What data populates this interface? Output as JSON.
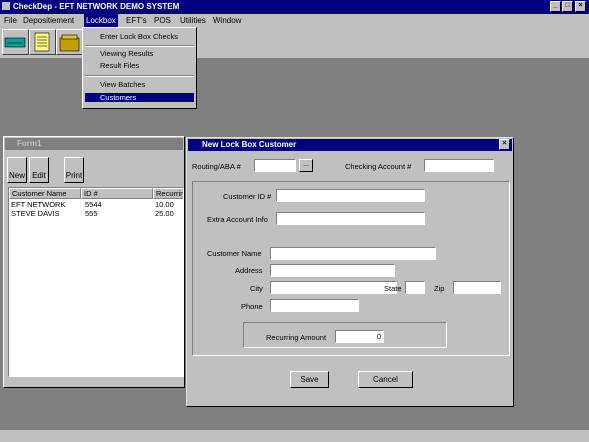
{
  "app": {
    "title": "CheckDep - EFT NETWORK DEMO SYSTEM",
    "min": "_",
    "max": "□",
    "close": "×"
  },
  "menubar": [
    "File",
    "Depositiement",
    "Lockbox",
    "EFT's",
    "POS",
    "Utilities",
    "Window"
  ],
  "lockbox_menu": [
    "Enter Lock Box Checks",
    "Viewing Results",
    "Result Files",
    "View Batches",
    "Customers"
  ],
  "form1": {
    "title": "Form1",
    "buttons": [
      "New",
      "Edit",
      "Print"
    ],
    "columns": [
      "Customer Name",
      "ID #",
      "Recurring"
    ],
    "rows": [
      [
        "EFT NETWORK",
        "5544",
        "10.00"
      ],
      [
        "STEVE DAVIS",
        "555",
        "25.00"
      ]
    ]
  },
  "dialog": {
    "title": "New Lock Box Customer",
    "close": "×",
    "routing_label": "Routing/ABA #",
    "routing_btn": "...",
    "checking_label": "Checking Account #",
    "customer_id_label": "Customer ID #",
    "extra_account_label": "Extra Account Info",
    "customer_name_label": "Customer Name",
    "address_label": "Address",
    "city_label": "City",
    "state_label": "State",
    "zip_label": "Zip",
    "phone_label": "Phone",
    "recurring_label": "Recurring Amount",
    "recurring_value": "0",
    "save": "Save",
    "cancel": "Cancel"
  }
}
